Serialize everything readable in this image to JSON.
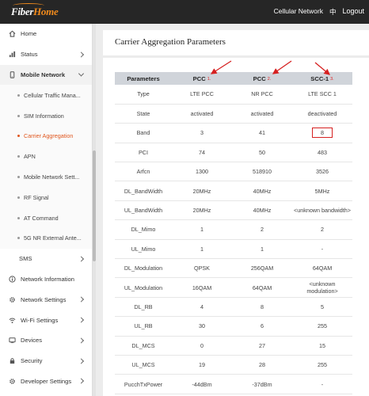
{
  "header": {
    "logo_main": "Fiber",
    "logo_accent": "Home",
    "network_label": "Cellular Network",
    "language": "中",
    "logout": "Logout"
  },
  "sidebar": {
    "home": "Home",
    "status": "Status",
    "mobile_network": "Mobile Network",
    "sub_items": [
      "Cellular Traffic Mana...",
      "SIM Information",
      "Carrier Aggregation",
      "APN",
      "Mobile Network Sett...",
      "RF Signal",
      "AT Command",
      "5G NR External Ante..."
    ],
    "sms": "SMS",
    "network_information": "Network Information",
    "network_settings": "Network Settings",
    "wifi_settings": "Wi-Fi Settings",
    "devices": "Devices",
    "security": "Security",
    "developer_settings": "Developer Settings"
  },
  "panel": {
    "title": "Carrier Aggregation Parameters"
  },
  "table": {
    "headers": [
      "Parameters",
      "PCC",
      "PCC",
      "SCC-1"
    ],
    "markers": [
      "1.",
      "2.",
      "3."
    ],
    "rows": [
      [
        "Type",
        "LTE PCC",
        "NR PCC",
        "LTE SCC 1"
      ],
      [
        "State",
        "activated",
        "activated",
        "deactivated"
      ],
      [
        "Band",
        "3",
        "41",
        "8"
      ],
      [
        "PCI",
        "74",
        "50",
        "483"
      ],
      [
        "Arfcn",
        "1300",
        "518910",
        "3526"
      ],
      [
        "DL_BandWidth",
        "20MHz",
        "40MHz",
        "5MHz"
      ],
      [
        "UL_BandWidth",
        "20MHz",
        "40MHz",
        "<unknown bandwidth>"
      ],
      [
        "DL_Mimo",
        "1",
        "2",
        "2"
      ],
      [
        "UL_Mimo",
        "1",
        "1",
        "-"
      ],
      [
        "DL_Modulation",
        "QPSK",
        "256QAM",
        "64QAM"
      ],
      [
        "UL_Modulation",
        "16QAM",
        "64QAM",
        "<unknown modulation>"
      ],
      [
        "DL_RB",
        "4",
        "8",
        "5"
      ],
      [
        "UL_RB",
        "30",
        "6",
        "255"
      ],
      [
        "DL_MCS",
        "0",
        "27",
        "15"
      ],
      [
        "UL_MCS",
        "19",
        "28",
        "255"
      ],
      [
        "PucchTxPower",
        "-44dBm",
        "-37dBm",
        "-"
      ]
    ]
  },
  "colors": {
    "accent": "#e0561d",
    "annotation": "#d62020",
    "header_bg": "#262626",
    "table_header_bg": "#d0d4da"
  }
}
